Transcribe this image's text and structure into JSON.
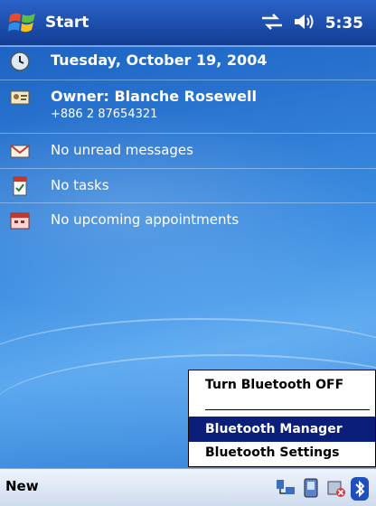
{
  "titlebar": {
    "start_label": "Start",
    "time": "5:35",
    "icons": [
      "windows-flag-icon",
      "connectivity-icon",
      "volume-icon"
    ]
  },
  "today": {
    "date": "Tuesday, October 19, 2004",
    "owner_name": "Owner: Blanche Rosewell",
    "owner_phone": "+886 2 87654321",
    "messages": "No unread messages",
    "tasks": "No tasks",
    "appointments": "No upcoming appointments"
  },
  "popup_menu": {
    "items": [
      "Turn Bluetooth OFF",
      "Bluetooth Manager",
      "Bluetooth Settings"
    ],
    "selected": "Bluetooth Manager"
  },
  "bottombar": {
    "new_label": "New",
    "tray_icons": [
      "network-icon",
      "device-icon",
      "sync-icon",
      "bluetooth-icon"
    ]
  },
  "colors": {
    "titlebar": "#1b4fae",
    "menu_selection": "#0a1e7a",
    "background": "#2f7fd6"
  }
}
